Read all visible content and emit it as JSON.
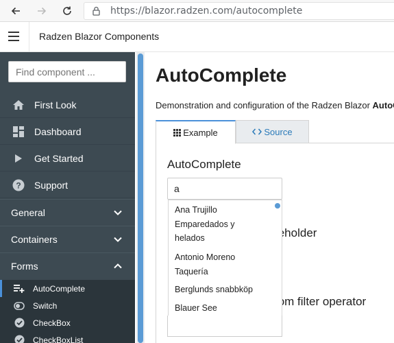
{
  "browser": {
    "url": "https://blazor.radzen.com/autocomplete"
  },
  "header": {
    "title": "Radzen Blazor Components"
  },
  "sidebar": {
    "search_placeholder": "Find component ...",
    "top_items": [
      {
        "label": "First Look",
        "icon": "home-icon"
      },
      {
        "label": "Dashboard",
        "icon": "dashboard-icon"
      },
      {
        "label": "Get Started",
        "icon": "play-icon"
      },
      {
        "label": "Support",
        "icon": "help-icon"
      }
    ],
    "groups": [
      {
        "label": "General",
        "expanded": false
      },
      {
        "label": "Containers",
        "expanded": false
      },
      {
        "label": "Forms",
        "expanded": true
      }
    ],
    "form_items": [
      {
        "label": "AutoComplete",
        "icon": "playlist-add-icon",
        "active": true
      },
      {
        "label": "Switch",
        "icon": "toggle-icon",
        "active": false
      },
      {
        "label": "CheckBox",
        "icon": "check-circle-icon",
        "active": false
      },
      {
        "label": "CheckBoxList",
        "icon": "check-circle-icon",
        "active": false
      }
    ],
    "colors": {
      "background": "#3d4a52",
      "accent": "#4a90d9"
    }
  },
  "main": {
    "title": "AutoComplete",
    "description_prefix": "Demonstration and configuration of the Radzen Blazor ",
    "description_bold": "AutoC",
    "tabs": [
      {
        "label": "Example",
        "icon": "grid-icon",
        "active": true
      },
      {
        "label": "Source",
        "icon": "code-icon",
        "active": false
      }
    ],
    "sections": [
      {
        "title": "AutoComplete"
      },
      {
        "title": "teholder"
      },
      {
        "title": "tom filter operator"
      }
    ],
    "autocomplete": {
      "value": "a",
      "suggestions": [
        "Ana Trujillo Emparedados y helados",
        "Antonio Moreno Taquería",
        "Berglunds snabbköp",
        "Blauer See"
      ]
    }
  }
}
